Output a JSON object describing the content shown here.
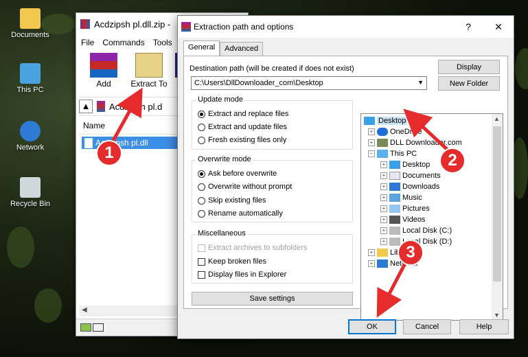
{
  "desktop": {
    "icons": [
      {
        "label": "Documents"
      },
      {
        "label": "This PC"
      },
      {
        "label": "Network"
      },
      {
        "label": "Recycle Bin"
      }
    ]
  },
  "winrar": {
    "title": "Acdzipsh pl.dll.zip - ",
    "menu": [
      "File",
      "Commands",
      "Tools"
    ],
    "toolbar": {
      "add_label": "Add",
      "extract_label": "Extract To"
    },
    "address": "Acdzipsh pl.d",
    "column_name": "Name",
    "file_row": "Acdzipsh pl.dll"
  },
  "dialog": {
    "title": "Extraction path and options",
    "help_glyph": "?",
    "close_glyph": "✕",
    "tabs": [
      "General",
      "Advanced"
    ],
    "destination_label": "Destination path (will be created if does not exist)",
    "destination_value": "C:\\Users\\DllDownloader_com\\Desktop",
    "display_button": "Display",
    "new_folder_button": "New Folder",
    "update_mode": {
      "title": "Update mode",
      "options": [
        "Extract and replace files",
        "Extract and update files",
        "Fresh existing files only"
      ]
    },
    "overwrite_mode": {
      "title": "Overwrite mode",
      "options": [
        "Ask before overwrite",
        "Overwrite without prompt",
        "Skip existing files",
        "Rename automatically"
      ]
    },
    "miscellaneous": {
      "title": "Miscellaneous",
      "options": [
        "Extract archives to subfolders",
        "Keep broken files",
        "Display files in Explorer"
      ]
    },
    "save_settings": "Save settings",
    "tree": {
      "root": "Desktop",
      "items": [
        "OneDrive",
        "DLL Downloader.com",
        "This PC",
        "Desktop",
        "Documents",
        "Downloads",
        "Music",
        "Pictures",
        "Videos",
        "Local Disk (C:)",
        "Local Disk (D:)",
        "Libraries",
        "Network"
      ]
    },
    "ok_button": "OK",
    "cancel_button": "Cancel",
    "help_button": "Help"
  },
  "markers": [
    "1",
    "2",
    "3"
  ],
  "colors": {
    "marker": "#e52b2b",
    "selection": "#3d8ee6",
    "ok_border": "#0078d7"
  }
}
